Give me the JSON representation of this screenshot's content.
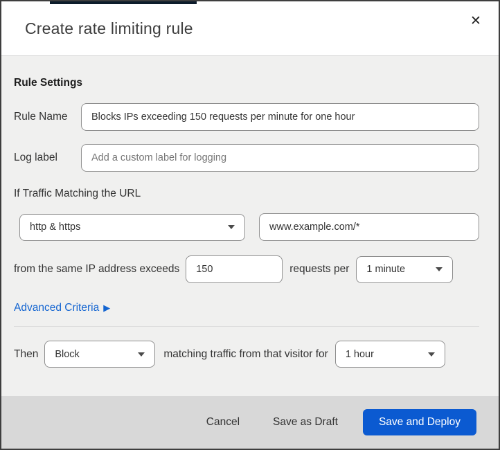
{
  "modal": {
    "title": "Create rate limiting rule",
    "icons": {
      "close": "✕",
      "advanced_arrow": "▶"
    }
  },
  "form": {
    "section_heading": "Rule Settings",
    "rule_name": {
      "label": "Rule Name",
      "value": "Blocks IPs exceeding 150 requests per minute for one hour"
    },
    "log_label": {
      "label": "Log label",
      "placeholder": "Add a custom label for logging"
    },
    "traffic_match": {
      "intro": "If Traffic Matching the URL",
      "scheme_selected": "http & https",
      "url_value": "www.example.com/*",
      "threshold_prefix": "from the same IP address exceeds",
      "threshold_value": "150",
      "threshold_suffix": "requests per",
      "period_selected": "1 minute"
    },
    "advanced_link_label": "Advanced Criteria",
    "then": {
      "label": "Then",
      "action_selected": "Block",
      "middle_text": "matching traffic from that visitor for",
      "duration_selected": "1 hour"
    }
  },
  "footer": {
    "cancel_label": "Cancel",
    "save_draft_label": "Save as Draft",
    "save_deploy_label": "Save and Deploy"
  },
  "colors": {
    "link_blue": "#1465d1",
    "primary_button_blue": "#0b5ad1",
    "body_background": "#f0f0ef",
    "footer_background": "#d8d8d8",
    "page_strip_navy": "#0d1c2b"
  }
}
